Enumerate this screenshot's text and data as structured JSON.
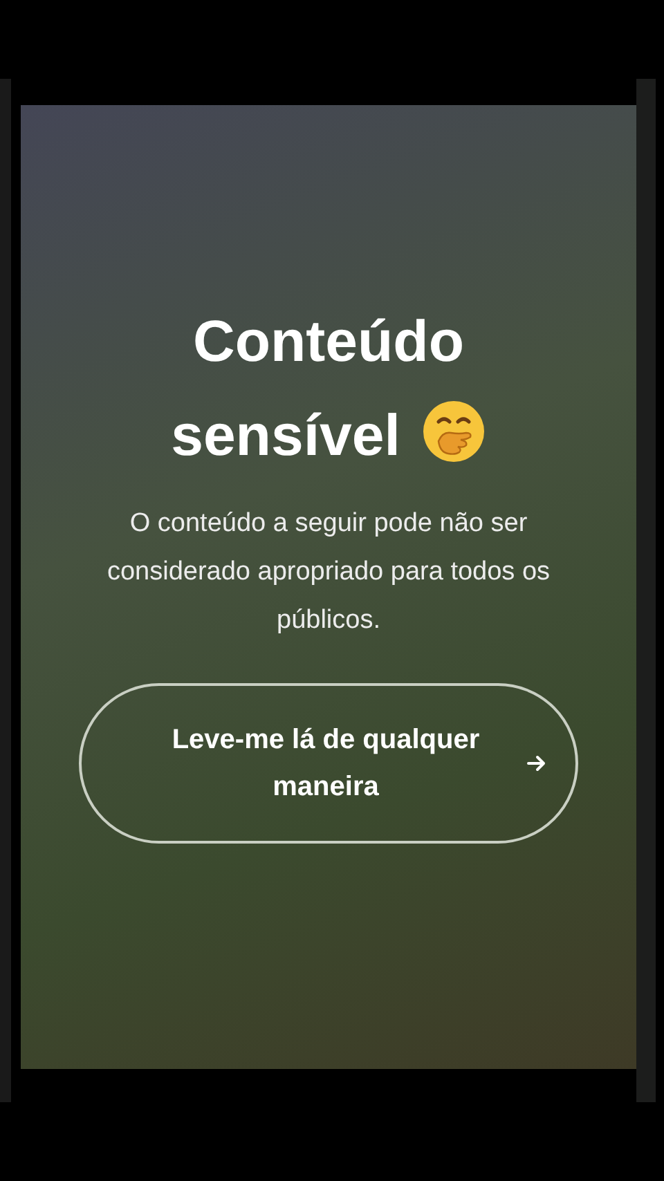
{
  "warning": {
    "title": "Conteúdo sensível",
    "message": "O conteúdo a seguir pode não ser considerado apropriado para todos os públicos.",
    "button": {
      "label": "Leve-me lá de qualquer maneira"
    }
  }
}
